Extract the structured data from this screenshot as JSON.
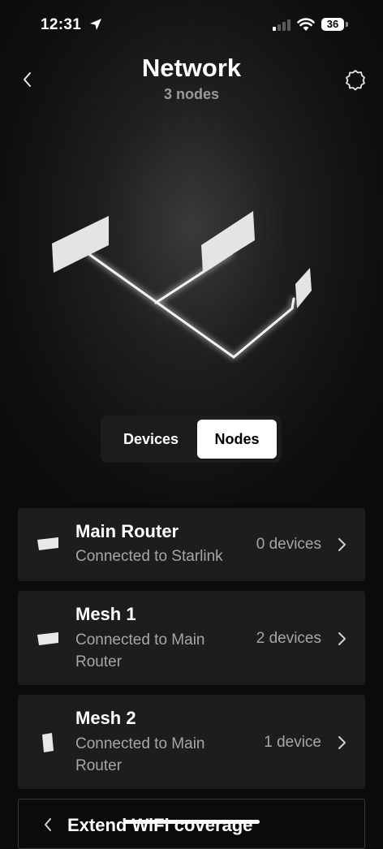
{
  "status_bar": {
    "time": "12:31",
    "battery": "36"
  },
  "header": {
    "title": "Network",
    "subtitle": "3 nodes"
  },
  "segmented": {
    "devices_label": "Devices",
    "nodes_label": "Nodes",
    "selected": "Nodes"
  },
  "nodes": [
    {
      "name": "Main Router",
      "desc": "Connected to Starlink",
      "count": "0 devices"
    },
    {
      "name": "Mesh 1",
      "desc": "Connected to Main Router",
      "count": "2 devices"
    },
    {
      "name": "Mesh 2",
      "desc": "Connected to Main Router",
      "count": "1 device"
    }
  ],
  "extend": {
    "label": "Extend WiFi coverage"
  },
  "colors": {
    "background": "#0b0b0b",
    "card": "#1d1d1d",
    "secondary_text": "#a6a6a6",
    "selected_segment": "#ffffff"
  }
}
